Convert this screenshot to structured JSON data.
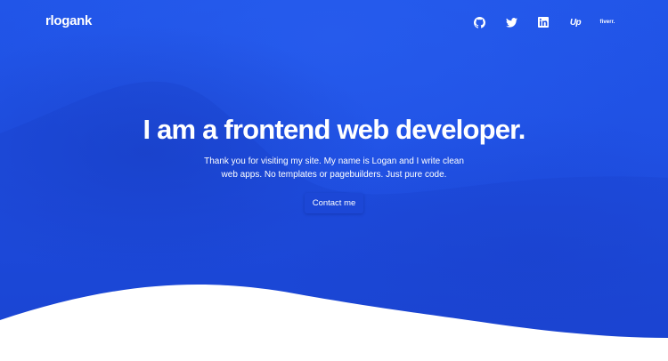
{
  "colors": {
    "hero_blue": "#1f51e4",
    "hero_blue_dark": "#1c45d3",
    "button_bg": "#1c47d6",
    "text": "#ffffff",
    "page_bg": "#ffffff"
  },
  "header": {
    "logo": "rlogank",
    "social": [
      {
        "name": "github",
        "icon": "github-icon"
      },
      {
        "name": "twitter",
        "icon": "twitter-icon"
      },
      {
        "name": "linkedin",
        "icon": "linkedin-icon"
      },
      {
        "name": "upwork",
        "icon": "upwork-icon",
        "text": "Up"
      },
      {
        "name": "fiverr",
        "icon": "fiverr-icon",
        "text": "fiverr."
      }
    ]
  },
  "hero": {
    "title": "I am a frontend web developer.",
    "text": "Thank you for visiting my site. My name is Logan and I write clean web apps. No templates or pagebuilders. Just pure code.",
    "cta_label": "Contact me"
  }
}
